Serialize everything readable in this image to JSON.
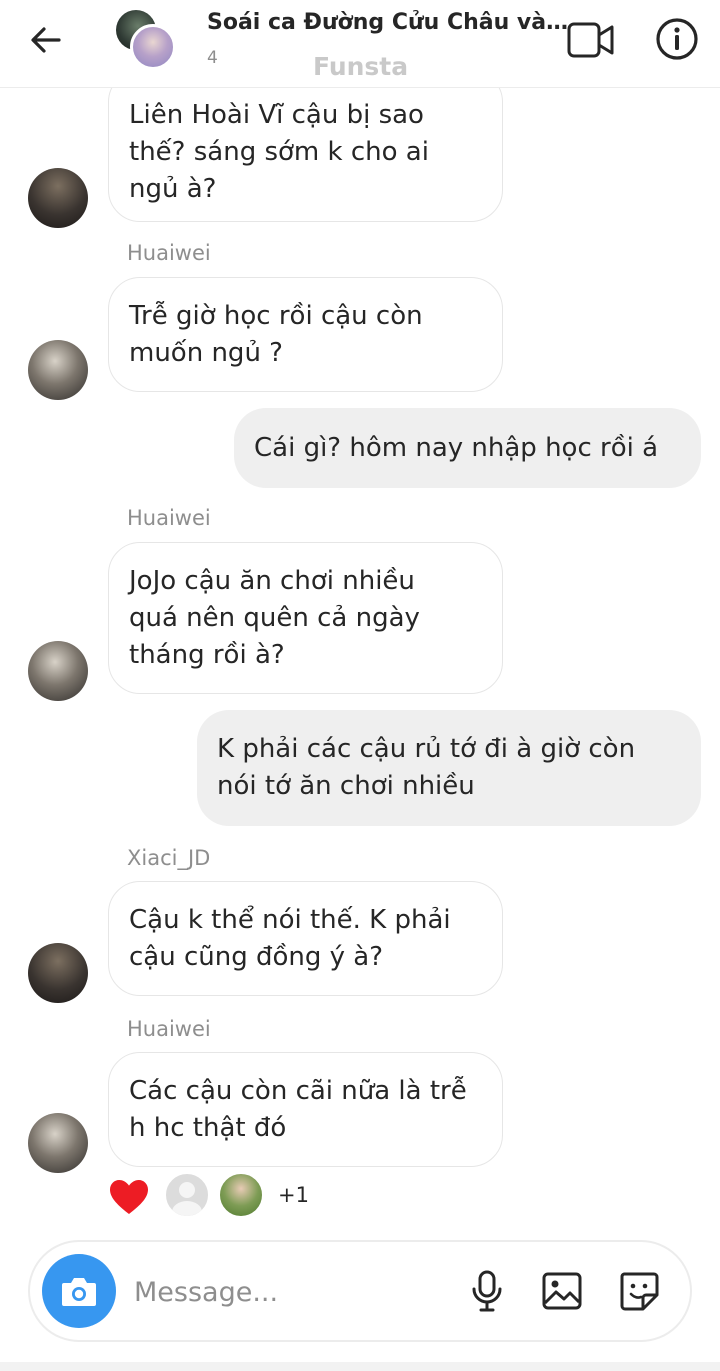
{
  "header": {
    "title": "Soái ca Đường Cửu Châu và ...",
    "member_count": "4",
    "app_label": "Funsta"
  },
  "messages": [
    {
      "sender": "",
      "text": "Liên Hoài Vĩ cậu bị sao thế? sáng sớm k cho ai ngủ à?",
      "direction": "incoming"
    },
    {
      "sender": "Huaiwei",
      "text": "Trễ giờ học rồi cậu còn muốn ngủ ?",
      "direction": "incoming"
    },
    {
      "sender": "",
      "text": "Cái gì? hôm nay nhập học rồi á",
      "direction": "outgoing"
    },
    {
      "sender": "Huaiwei",
      "text": "JoJo cậu ăn chơi nhiều quá nên quên cả ngày tháng rồi à?",
      "direction": "incoming"
    },
    {
      "sender": "",
      "text": "K phải các cậu rủ tớ đi à giờ còn nói tớ ăn chơi nhiều",
      "direction": "outgoing"
    },
    {
      "sender": "Xiaci_JD",
      "text": "Cậu k thể nói thế. K phải cậu cũng đồng ý à?",
      "direction": "incoming"
    },
    {
      "sender": "Huaiwei",
      "text": "Các cậu còn cãi nữa là trễ h hc thật đó",
      "direction": "incoming"
    }
  ],
  "lines": {
    "m0": [
      "Liên Hoài Vĩ cậu bị sao",
      "thế? sáng sớm k cho ai",
      "ngủ à?"
    ],
    "m1": [
      "Trễ giờ học rồi cậu còn",
      "muốn ngủ ?"
    ],
    "m2": [
      "Cái gì? hôm nay nhập học rồi á"
    ],
    "m3": [
      "JoJo cậu ăn chơi nhiều",
      "quá nên quên cả ngày",
      "tháng rồi à?"
    ],
    "m4": [
      "K phải các cậu rủ tớ đi à giờ còn",
      "nói tớ ăn chơi nhiều"
    ],
    "m5": [
      "Cậu k thể nói thế. K phải",
      "cậu cũng đồng ý à?"
    ],
    "m6": [
      "Các cậu còn cãi nữa là trễ",
      "h hc thật đó"
    ]
  },
  "reactions": {
    "emoji_icon": "heart-icon",
    "more_count": "+1",
    "heart_color": "#ed1c24"
  },
  "composer": {
    "placeholder": "Message..."
  },
  "colors": {
    "accent": "#3797f0",
    "outgoing_bubble": "#efefef",
    "incoming_border": "#e6e6e6"
  }
}
